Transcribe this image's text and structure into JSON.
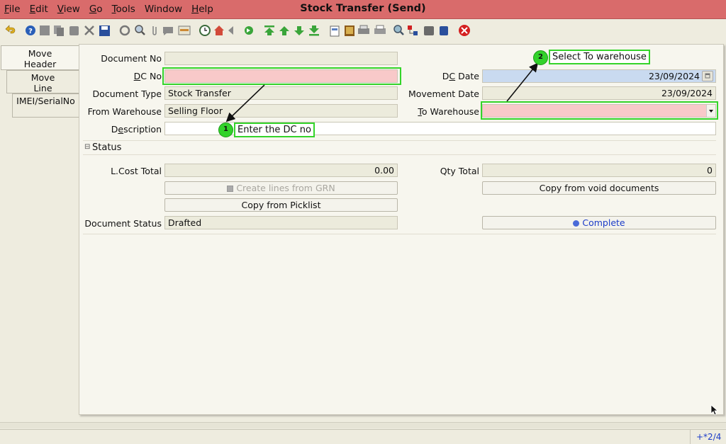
{
  "window": {
    "title": "Stock Transfer (Send)"
  },
  "menu": {
    "file": {
      "mn": "F",
      "rest": "ile"
    },
    "edit": {
      "mn": "E",
      "rest": "dit"
    },
    "view": {
      "mn": "V",
      "rest": "iew"
    },
    "go": {
      "mn": "G",
      "rest": "o"
    },
    "tools": {
      "mn": "T",
      "rest": "ools"
    },
    "window": {
      "label": "Window"
    },
    "help": {
      "mn": "H",
      "rest": "elp"
    }
  },
  "toolbar_icons": [
    "undo-icon",
    "help-icon",
    "new-icon",
    "copy-icon",
    "delete-icon",
    "delete-selection-icon",
    "save-icon",
    "refresh-icon",
    "find-icon",
    "attachment-icon",
    "chat-icon",
    "grid-toggle-icon",
    "history-icon",
    "home-icon",
    "back-icon",
    "forward-icon",
    "first-record-icon",
    "previous-record-icon",
    "next-record-icon",
    "last-record-icon",
    "report-icon",
    "archive-icon",
    "print-preview-icon",
    "print-icon",
    "zoom-across-icon",
    "workflow-icon",
    "product-info-icon",
    "lock-icon",
    "close-window-icon"
  ],
  "tabs": {
    "move_header": "Move\nHeader",
    "move_line": "Move\nLine",
    "imei": "IMEI/SerialNo"
  },
  "form": {
    "document_no": {
      "label": "Document No",
      "value": ""
    },
    "dc_no": {
      "label_mn": "D",
      "label_rest": "C No",
      "value": ""
    },
    "document_type": {
      "label": "Document Type",
      "value": "Stock Transfer"
    },
    "from_warehouse": {
      "label": "From Warehouse",
      "value": "Selling Floor"
    },
    "description": {
      "label_pre": "D",
      "label_mn": "e",
      "label_rest": "scription",
      "value": ""
    },
    "dc_date": {
      "label_pre": "D",
      "label_mn": "C",
      "label_rest": " Date",
      "value": "23/09/2024"
    },
    "movement_date": {
      "label": "Movement Date",
      "value": "23/09/2024"
    },
    "to_warehouse": {
      "label_mn": "T",
      "label_rest": "o Warehouse",
      "value": ""
    }
  },
  "status_section": {
    "title": "Status",
    "toggle": "⊟"
  },
  "status": {
    "lcost_total": {
      "label": "L.Cost Total",
      "value": "0.00"
    },
    "qty_total": {
      "label": "Qty Total",
      "value": "0"
    },
    "create_lines_button": "Create lines from GRN",
    "copy_void_button": "Copy from void documents",
    "copy_picklist_button": "Copy from Picklist",
    "document_status": {
      "label": "Document Status",
      "value": "Drafted"
    },
    "complete_button": "Complete"
  },
  "annotations": {
    "step1": {
      "number": "1",
      "text": "Enter the DC no"
    },
    "step2": {
      "number": "2",
      "text": "Select To warehouse"
    }
  },
  "statusbar": {
    "right": "+*2/4"
  }
}
